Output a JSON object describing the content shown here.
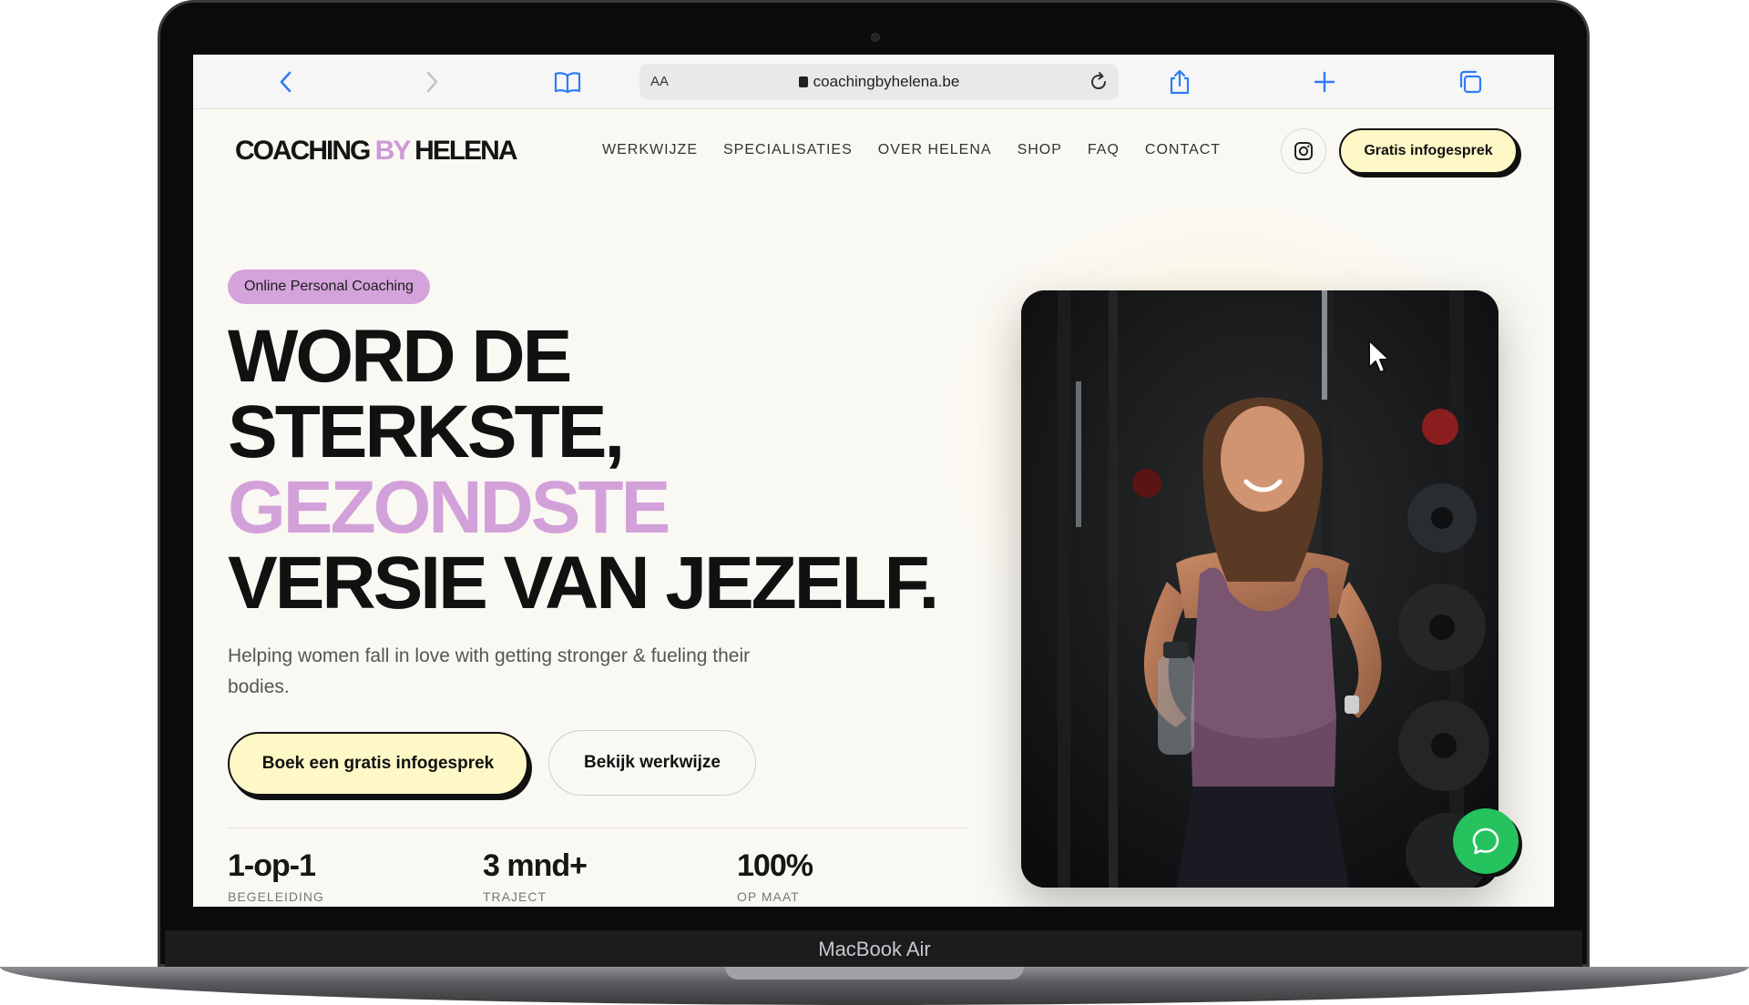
{
  "browser": {
    "aa_label": "AA",
    "url": "coachingbyhelena.be"
  },
  "site": {
    "logo_part1": "COACHING ",
    "logo_by": "BY",
    "logo_part2": " HELENA",
    "nav": [
      "WERKWIJZE",
      "SPECIALISATIES",
      "OVER HELENA",
      "SHOP",
      "FAQ",
      "CONTACT"
    ],
    "cta_top": "Gratis infogesprek"
  },
  "hero": {
    "badge": "Online Personal Coaching",
    "headline_line1": "WORD DE",
    "headline_line2": "STERKSTE,",
    "headline_accent": "GEZONDSTE",
    "headline_line4": "VERSIE VAN JEZELF.",
    "subtitle": "Helping women fall in love with getting stronger & fueling their bodies.",
    "primary_button": "Boek een gratis infogesprek",
    "secondary_button": "Bekijk werkwijze"
  },
  "stats": [
    {
      "value": "1-op-1",
      "label": "BEGELEIDING"
    },
    {
      "value": "3 mnd+",
      "label": "TRAJECT"
    },
    {
      "value": "100%",
      "label": "OP MAAT"
    }
  ],
  "device": {
    "label": "MacBook Air"
  },
  "colors": {
    "accent_lilac": "#d3a1da",
    "cta_yellow": "#fef8c6",
    "page_bg": "#faf8f2",
    "chat_green": "#25c25e"
  }
}
